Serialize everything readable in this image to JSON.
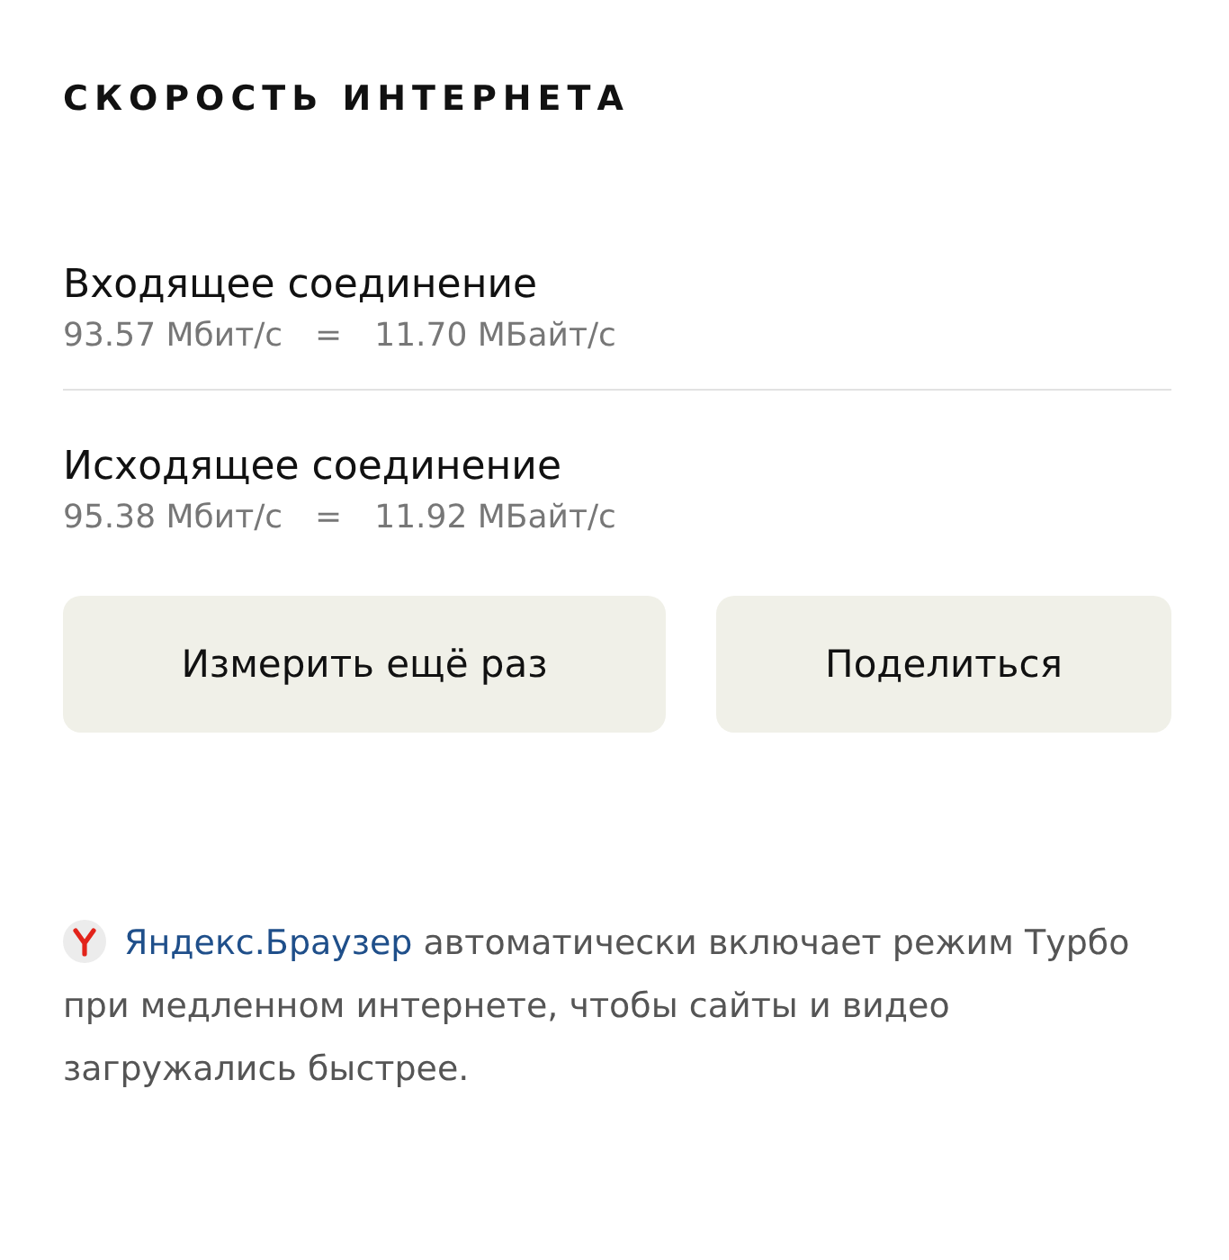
{
  "title": "СКОРОСТЬ ИНТЕРНЕТА",
  "connections": [
    {
      "label": "Входящее соединение",
      "bits": "93.57 Мбит/с",
      "equals": "=",
      "bytes": "11.70 МБайт/с"
    },
    {
      "label": "Исходящее соединение",
      "bits": "95.38 Мбит/с",
      "equals": "=",
      "bytes": "11.92 МБайт/с"
    }
  ],
  "buttons": [
    "Измерить ещё раз",
    "Поделиться"
  ],
  "note": {
    "link": "Яндекс.Браузер",
    "text": "автоматически включает режим Турбо при медленном интернете, чтобы сайты и видео загружались быстрее."
  }
}
